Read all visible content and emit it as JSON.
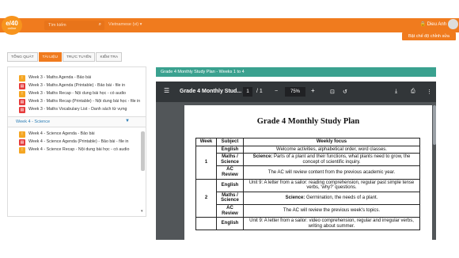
{
  "header": {
    "logo_text": "e/40",
    "logo_sub": "online",
    "search_placeholder": "Tìm kiếm",
    "language": "Vietnamese (vi)",
    "user_name": "Dieu Anh",
    "contrast_button": "Bật chế độ chỉnh sửa"
  },
  "tabs": [
    "TỔNG QUÁT",
    "TÀI LIỆU",
    "TRỰC TUYẾN",
    "KIỂM TRA"
  ],
  "sidebar": {
    "week3_items": [
      "Week 3 - Maths Agenda - Bảo bài",
      "Week 3 - Maths Agenda (Printable) - Bảo bài - file in",
      "Week 3 - Maths Recap - Nội dung bài học - có audio",
      "Week 3 - Maths Recap (Printable) - Nội dung bài học - file in",
      "Week 3 - Maths Vocabulary List - Danh sách từ vựng"
    ],
    "section_title": "Week 4 - Science",
    "week4_items": [
      "Week 4 - Science Agenda - Bảo bài",
      "Week 4 - Science Agenda (Printable) - Bảo bài - file in",
      "Week 4 - Science Recap - Nội dung bài học - có audio"
    ]
  },
  "pdf": {
    "panel_title": "Grade 4 Monthly Study Plan - Weeks 1 to 4",
    "toolbar_title": "Grade 4 Monthly Stud...",
    "current_page": "1",
    "total_pages": "/ 1",
    "zoom": "75%",
    "doc_title": "Grade 4 Monthly Study Plan",
    "table_headers": [
      "Week",
      "Subject",
      "Weekly focus"
    ],
    "rows": {
      "w1": "1",
      "w1_english_subject": "English",
      "w1_english_focus": "Welcome activities, alphabetical order, word classes.",
      "w1_science_subject": "Maths / Science",
      "w1_science_focus_label": "Science:",
      "w1_science_focus": "Parts of a plant and their functions, what plants need to grow, the concept of scientific inquiry.",
      "w1_ac_subject": "AC Review",
      "w1_ac_focus": "The AC will review content from the previous academic year.",
      "w2": "2",
      "w2_english_subject": "English",
      "w2_english_focus": "Unit 9: A letter from a sailor: reading comprehension, regular past simple tense verbs, 'why?' questions.",
      "w2_science_subject": "Maths / Science",
      "w2_science_focus_label": "Science:",
      "w2_science_focus": "Germination, the needs of a plant.",
      "w2_ac_subject": "AC Review",
      "w2_ac_focus": "The AC will review the previous week's topics.",
      "w3_english_subject": "English",
      "w3_english_focus": "Unit 9: A letter from a sailor: video comprehension, regular and irregular verbs, writing about summer."
    }
  }
}
